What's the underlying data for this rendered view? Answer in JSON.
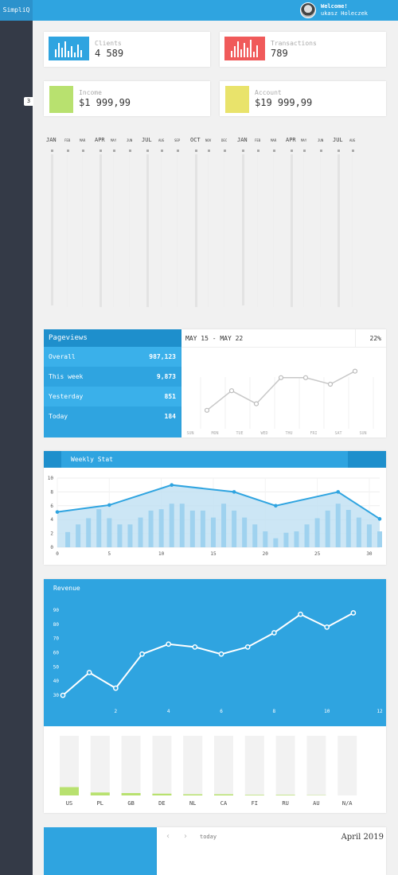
{
  "header": {
    "brand": "SimpliQ",
    "welcome": "Welcome!",
    "user_name": "ukasz Holeczek"
  },
  "sidebar": {
    "badge": "3"
  },
  "stats": {
    "clients": {
      "label": "Clients",
      "value": "4 589",
      "color": "#2fa4e0"
    },
    "transactions": {
      "label": "Transactions",
      "value": "789",
      "color": "#f05a5a"
    },
    "income": {
      "label": "Income",
      "value": "$1 999,99",
      "color": "#b8e16f"
    },
    "account": {
      "label": "Account",
      "value": "$19 999,99",
      "color": "#e9e36b"
    }
  },
  "timeline": {
    "months": [
      "JAN",
      "FEB",
      "MAR",
      "APR",
      "MAY",
      "JUN",
      "JUL",
      "AUG",
      "SEP",
      "OCT",
      "NOV",
      "DEC",
      "JAN",
      "FEB",
      "MAR",
      "APR",
      "MAY",
      "JUN",
      "JUL",
      "AUG"
    ]
  },
  "pageviews": {
    "title": "Pageviews",
    "rows": [
      {
        "label": "Overall",
        "value": "987,123"
      },
      {
        "label": "This week",
        "value": "9,873"
      },
      {
        "label": "Yesterday",
        "value": "851"
      },
      {
        "label": "Today",
        "value": "184"
      }
    ],
    "range": "MAY 15 - MAY 22",
    "percent": "22%",
    "days": [
      "SUN",
      "MON",
      "TUE",
      "WED",
      "THU",
      "FRI",
      "SAT",
      "SUN"
    ]
  },
  "weekly_stat": {
    "title": "Weekly Stat"
  },
  "revenue": {
    "title": "Revenue"
  },
  "calendar": {
    "prev": "‹",
    "next": "›",
    "today": "today",
    "month": "April 2019"
  },
  "chart_data": [
    {
      "type": "line",
      "title": "",
      "categories": [
        "SUN",
        "MON",
        "TUE",
        "WED",
        "THU",
        "FRI",
        "SAT",
        "SUN"
      ],
      "values": [
        2,
        5,
        3,
        7,
        7,
        6,
        8
      ]
    },
    {
      "type": "area",
      "title": "Weekly Stat",
      "x": [
        0,
        5,
        11,
        17,
        21,
        27,
        31
      ],
      "series": [
        {
          "values": [
            5.1,
            6.1,
            9.0,
            8.0,
            6.0,
            8.0,
            4.1
          ]
        }
      ],
      "bars": {
        "x": [
          1,
          2,
          3,
          4,
          5,
          6,
          7,
          8,
          9,
          10,
          11,
          12,
          13,
          14,
          15,
          16,
          17,
          18,
          19,
          20,
          21,
          22,
          23,
          24,
          25,
          26,
          27,
          28,
          29,
          30,
          31
        ],
        "values": [
          2.2,
          3.3,
          4.2,
          5.5,
          4.2,
          3.3,
          3.3,
          4.3,
          5.3,
          5.5,
          6.3,
          6.3,
          5.3,
          5.3,
          4.3,
          6.3,
          5.3,
          4.3,
          3.3,
          2.3,
          1.3,
          2.1,
          2.3,
          3.3,
          4.2,
          5.3,
          6.3,
          5.4,
          4.3,
          3.3,
          2.3
        ]
      },
      "xticks": [
        0,
        5,
        10,
        15,
        20,
        25,
        30
      ],
      "yticks": [
        0,
        2,
        4,
        6,
        8,
        10
      ],
      "xlim": [
        0,
        31
      ],
      "ylim": [
        0,
        10
      ]
    },
    {
      "type": "line",
      "title": "Revenue",
      "x": [
        0,
        1,
        2,
        3,
        4,
        5,
        6,
        7,
        8,
        9,
        10,
        11,
        12
      ],
      "values": [
        30,
        46,
        35,
        59,
        66,
        64,
        59,
        64,
        74,
        87,
        78,
        88
      ],
      "xticks": [
        2,
        4,
        6,
        8,
        10,
        12
      ],
      "yticks": [
        30,
        40,
        50,
        60,
        70,
        80,
        90
      ],
      "xlim": [
        0,
        12.3
      ],
      "ylim": [
        25,
        95
      ]
    },
    {
      "type": "bar",
      "title": "",
      "categories": [
        "US",
        "PL",
        "GB",
        "DE",
        "NL",
        "CA",
        "FI",
        "RU",
        "AU",
        "N/A"
      ],
      "values": [
        14,
        5,
        4,
        3,
        2,
        2,
        1,
        1,
        0.5,
        0
      ],
      "ylim": [
        0,
        100
      ]
    }
  ]
}
